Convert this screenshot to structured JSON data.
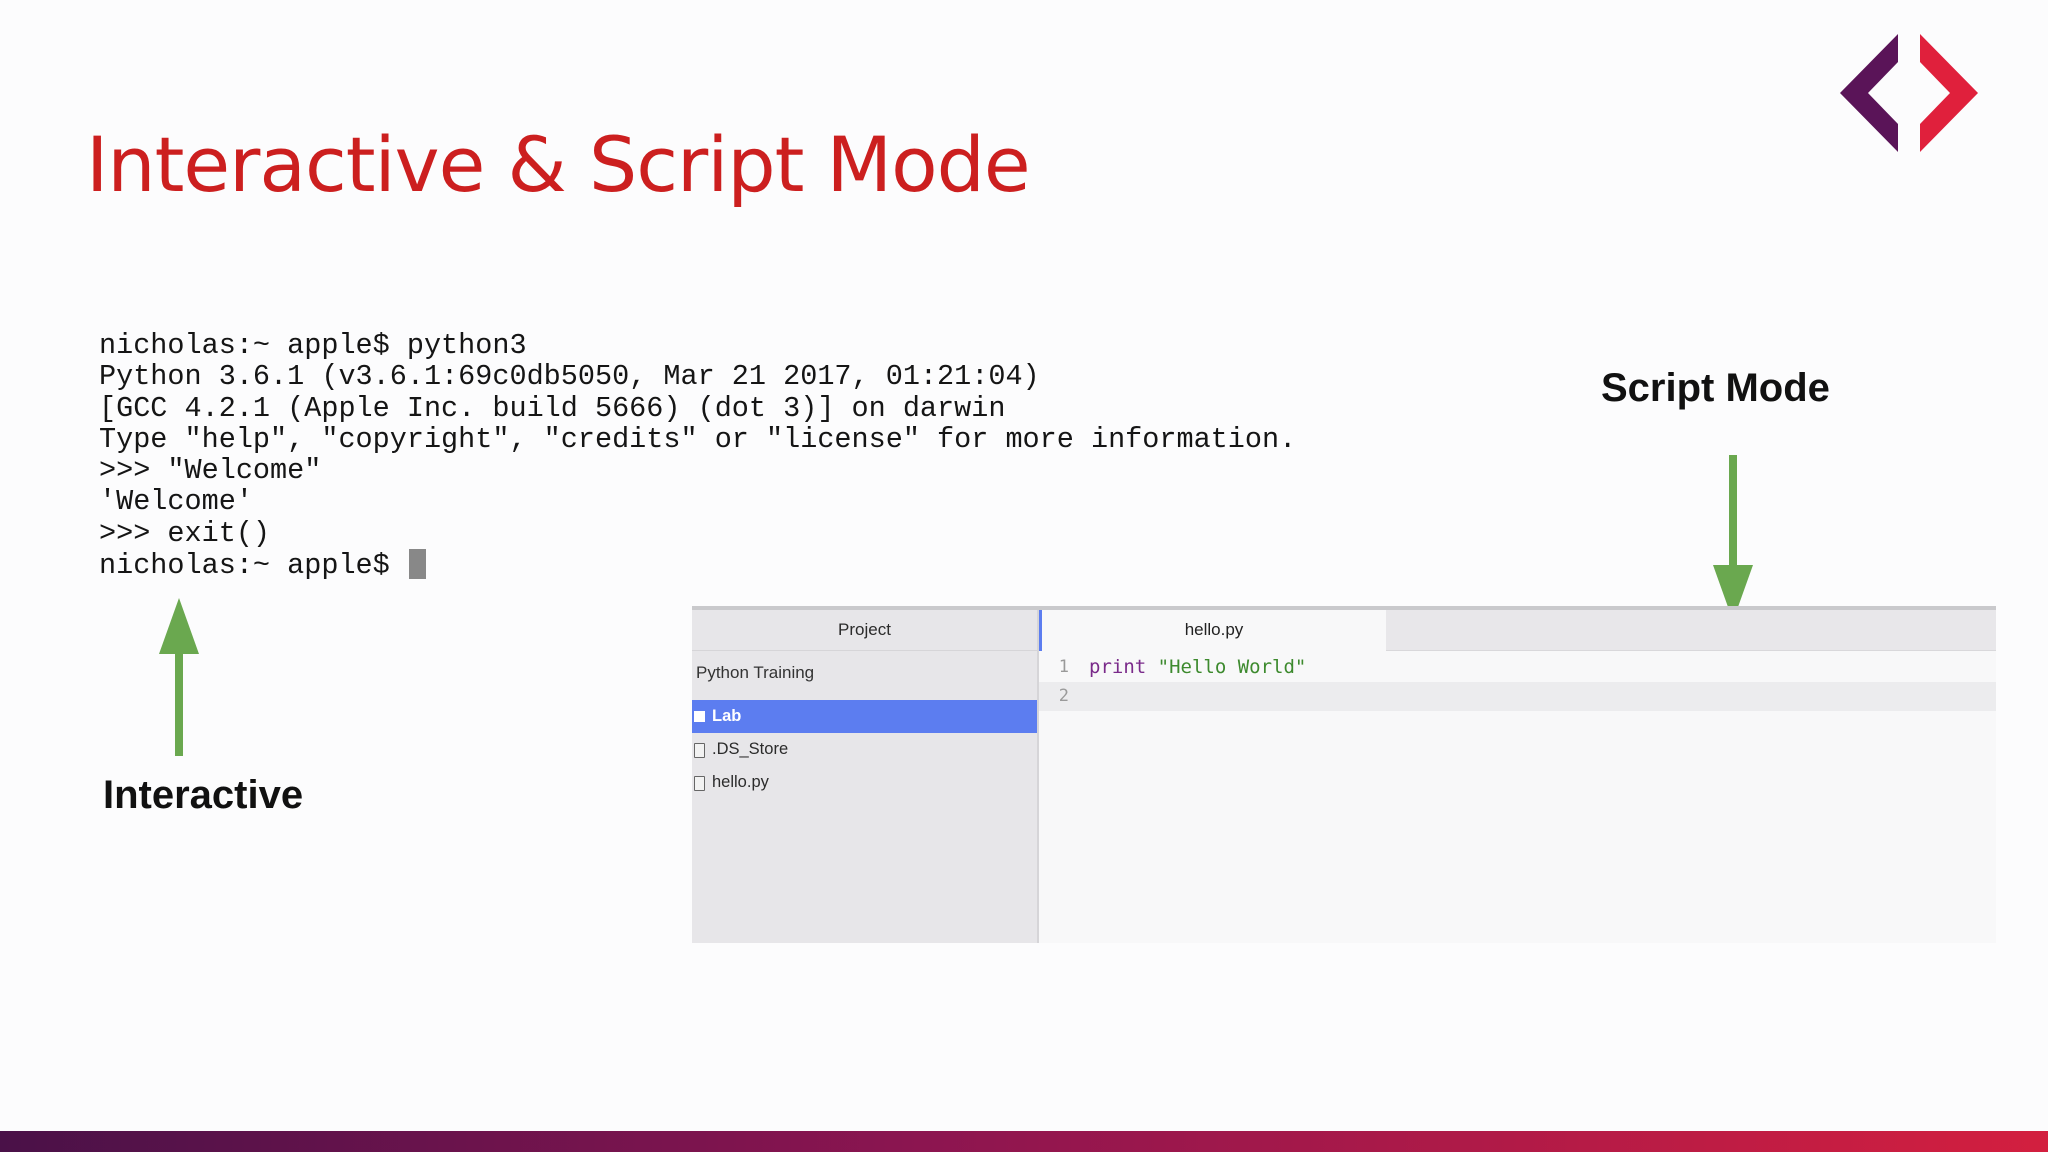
{
  "slide": {
    "title": "Interactive & Script Mode"
  },
  "terminal": {
    "lines": [
      "nicholas:~ apple$ python3",
      "Python 3.6.1 (v3.6.1:69c0db5050, Mar 21 2017, 01:21:04)",
      "[GCC 4.2.1 (Apple Inc. build 5666) (dot 3)] on darwin",
      "Type \"help\", \"copyright\", \"credits\" or \"license\" for more information.",
      ">>> \"Welcome\"",
      "'Welcome'",
      ">>> exit()",
      "nicholas:~ apple$ "
    ]
  },
  "labels": {
    "interactive": "Interactive",
    "script_mode": "Script Mode"
  },
  "editor": {
    "sidebar": {
      "tab_label": "Project",
      "project_name": "Python Training",
      "items": [
        {
          "label": "Lab",
          "type": "folder",
          "selected": true
        },
        {
          "label": ".DS_Store",
          "type": "file",
          "selected": false
        },
        {
          "label": "hello.py",
          "type": "file",
          "selected": false
        }
      ]
    },
    "tab_label": "hello.py",
    "code": {
      "line_numbers": [
        "1",
        "2"
      ],
      "keyword": "print",
      "string": "\"Hello World\""
    }
  },
  "colors": {
    "title": "#cc1f1f",
    "arrow": "#6aa84f",
    "selection": "#5c7df0",
    "logo_left": "#5a1458",
    "logo_right": "#e0203c"
  }
}
